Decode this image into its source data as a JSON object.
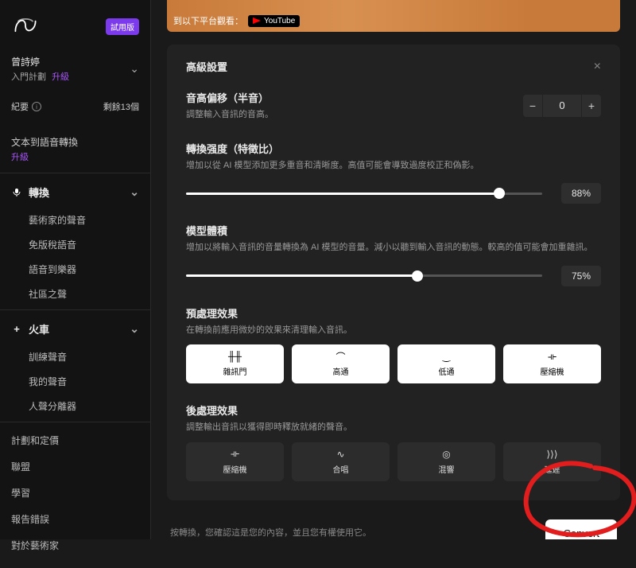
{
  "sidebar": {
    "trial_badge": "試用版",
    "user_name": "曾詩婷",
    "plan_label": "入門計劃",
    "upgrade_label": "升級",
    "quota_left_label": "紀要",
    "quota_right_label": "剩餘13個",
    "tts_label": "文本到語音轉換",
    "tts_upgrade": "升級",
    "groups": {
      "convert": {
        "label": "轉換",
        "items": [
          "藝術家的聲音",
          "免版稅語音",
          "語音到樂器",
          "社區之聲"
        ]
      },
      "train": {
        "label": "火車",
        "items": [
          "訓練聲音",
          "我的聲音",
          "人聲分離器"
        ]
      }
    },
    "links": [
      "計劃和定價",
      "聯盟",
      "學習",
      "報告錯誤",
      "對於藝術家"
    ]
  },
  "video": {
    "watch_on_label": "到以下平台觀看：",
    "youtube_label": "YouTube"
  },
  "panel": {
    "title": "高級設置",
    "pitch": {
      "title": "音高偏移（半音）",
      "desc": "調整輸入音訊的音高。",
      "value": "0"
    },
    "strength": {
      "title": "轉換强度（特徵比）",
      "desc": "增加以從 AI 模型添加更多重音和清晰度。高值可能會導致過度校正和偽影。",
      "value": "88%",
      "fill": 88
    },
    "volume": {
      "title": "模型體積",
      "desc": "增加以將輸入音訊的音量轉換為 AI 模型的音量。減小以聽到輸入音訊的動態。較高的值可能會加重雜訊。",
      "value": "75%",
      "fill": 65
    },
    "pre": {
      "title": "預處理效果",
      "desc": "在轉換前應用微妙的效果來清理輸入音訊。",
      "items": [
        "雜訊門",
        "高通",
        "低通",
        "壓縮機"
      ]
    },
    "post": {
      "title": "後處理效果",
      "desc": "調整輸出音訊以獲得即時釋放就緒的聲音。",
      "items": [
        "壓縮機",
        "合唱",
        "混響",
        "延遲"
      ]
    },
    "disclaimer": "按轉換，您確認這是您的內容，並且您有權使用它。",
    "convert_label": "Convert"
  }
}
